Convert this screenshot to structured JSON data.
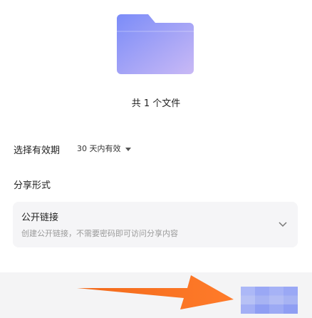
{
  "file_count_text": "共 1 个文件",
  "validity": {
    "label": "选择有效期",
    "value": "30 天内有效"
  },
  "share_form": {
    "label": "分享形式",
    "option": {
      "title": "公开链接",
      "description": "创建公开链接，不需要密码即可访问分享内容"
    }
  },
  "colors": {
    "folder_primary": "#7b8cf8",
    "folder_secondary": "#c9b9f5",
    "arrow": "#f26a1b",
    "card_bg": "#f5f5f7",
    "footer_bg": "#f4f4f5",
    "button_blur": "#9aa8f5"
  },
  "icons": {
    "folder": "folder-icon",
    "validity_dropdown": "caret-down-icon",
    "share_card_expand": "chevron-down-icon",
    "annotation": "arrow-right-icon"
  }
}
